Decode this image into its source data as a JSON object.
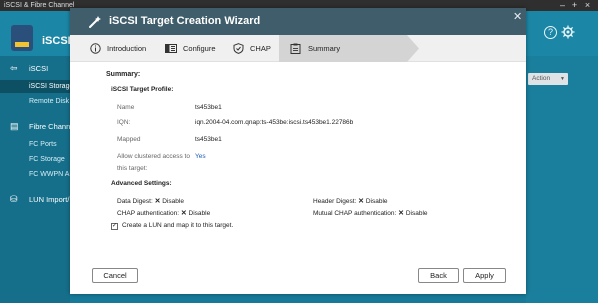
{
  "window": {
    "title": "iSCSI & Fibre Channel"
  },
  "app": {
    "title": "iSCSI",
    "sidebar": {
      "iscsi_section": "iSCSI",
      "iscsi_items": [
        "iSCSI Storage",
        "Remote Disk"
      ],
      "fc_section": "Fibre Channel",
      "fc_items": [
        "FC Ports",
        "FC Storage",
        "FC WWPN Aliases"
      ],
      "lun_section": "LUN Import/Export"
    },
    "action_label": "Action"
  },
  "dialog": {
    "title": "iSCSI Target Creation Wizard",
    "steps": [
      "Introduction",
      "Configure",
      "CHAP",
      "Summary"
    ],
    "active_step": "Summary",
    "summary_heading": "Summary:",
    "profile_heading": "iSCSI Target Profile:",
    "fields": {
      "name_label": "Name",
      "name_value": "ts453be1",
      "iqn_label": "IQN:",
      "iqn_value": "iqn.2004-04.com.qnap:ts-453be:iscsi.ts453be1.22786b",
      "mapped_label": "Mapped",
      "mapped_value": "ts453be1",
      "cluster_label_1": "Allow clustered access to",
      "cluster_label_2": "this target:",
      "cluster_value": "Yes"
    },
    "advanced_heading": "Advanced Settings:",
    "advanced": {
      "data_digest": "Data Digest:",
      "data_digest_value": "Disable",
      "header_digest": "Header Digest:",
      "header_digest_value": "Disable",
      "chap_auth": "CHAP authentication:",
      "chap_auth_value": "Disable",
      "mutual_chap": "Mutual CHAP authentication:",
      "mutual_chap_value": "Disable"
    },
    "create_lun_label": "Create a LUN and map it to this target.",
    "buttons": {
      "cancel": "Cancel",
      "back": "Back",
      "apply": "Apply"
    }
  }
}
